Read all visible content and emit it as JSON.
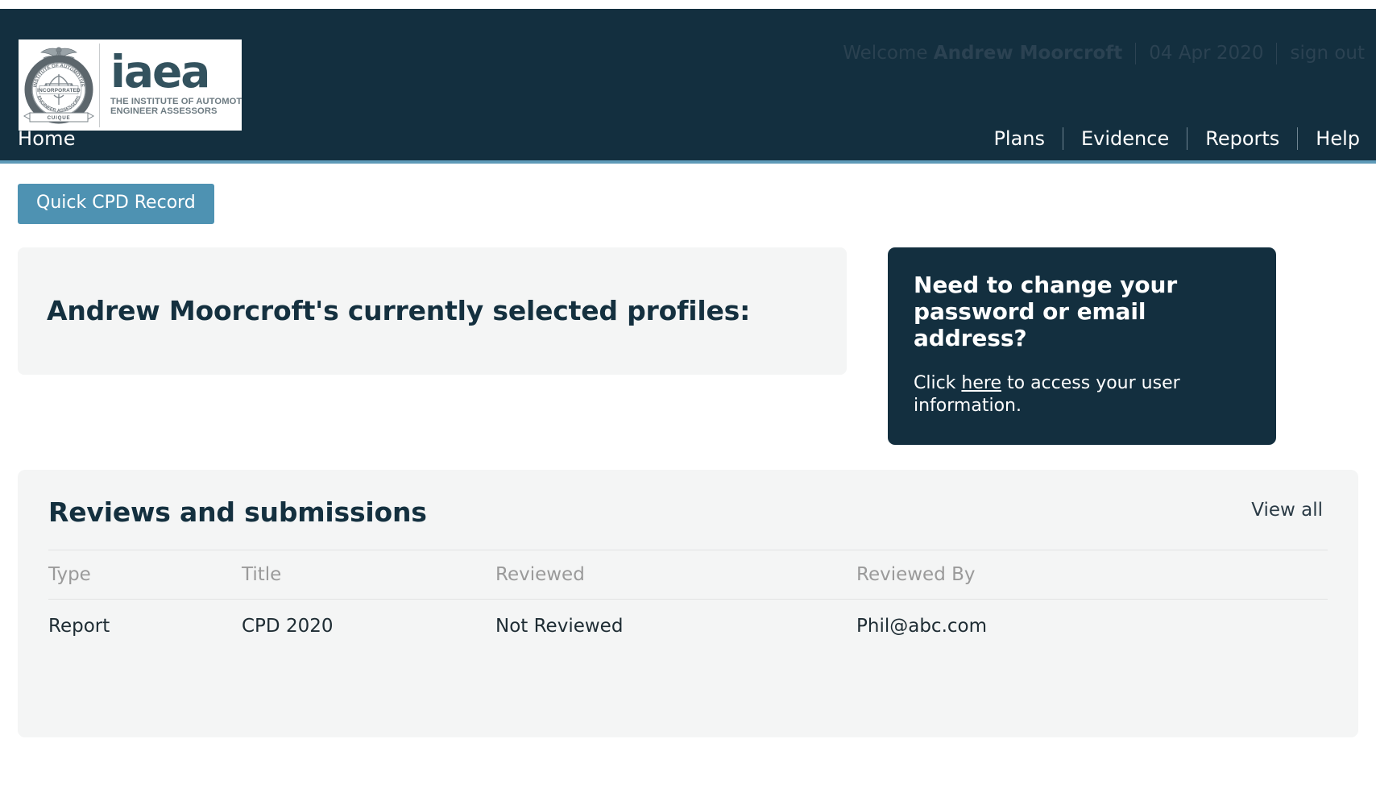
{
  "branding": {
    "logo_word": "iaea",
    "logo_tagline_line1": "THE INSTITUTE OF AUTOMOTIVE",
    "logo_tagline_line2": "ENGINEER ASSESSORS",
    "crest_text_top": "INSTITUTE OF AUTOMOTIVE",
    "crest_text_bottom": "ENGINEER ASSESSORS",
    "crest_center": "INCORPORATED",
    "crest_motto": "SUMM CUIQUE TRIBUT"
  },
  "header": {
    "welcome_prefix": "Welcome",
    "user_name": "Andrew Moorcroft",
    "date": "04 Apr 2020",
    "sign_out_label": "sign out"
  },
  "nav": {
    "home_label": "Home",
    "items": [
      {
        "label": "Plans"
      },
      {
        "label": "Evidence"
      },
      {
        "label": "Reports"
      },
      {
        "label": "Help"
      }
    ]
  },
  "toolbar": {
    "quick_cpd_label": "Quick CPD Record"
  },
  "profiles_panel": {
    "heading": "Andrew Moorcroft's currently selected profiles:"
  },
  "password_panel": {
    "heading": "Need to change your password or email address?",
    "body_before_link": "Click ",
    "link_label": "here",
    "body_after_link": " to access your user information."
  },
  "reviews": {
    "heading": "Reviews and submissions",
    "view_all_label": "View all",
    "columns": [
      "Type",
      "Title",
      "Reviewed",
      "Reviewed By"
    ],
    "rows": [
      {
        "type": "Report",
        "title": "CPD 2020",
        "reviewed": "Not Reviewed",
        "reviewed_by": "Phil@abc.com"
      }
    ]
  },
  "colors": {
    "header_dark": "#132f3f",
    "nav_accent": "#5e9ab8",
    "button_blue": "#4e92b2",
    "panel_grey": "#f4f5f5",
    "text_dark": "#14303f",
    "muted_header": "#9a9a9a"
  }
}
